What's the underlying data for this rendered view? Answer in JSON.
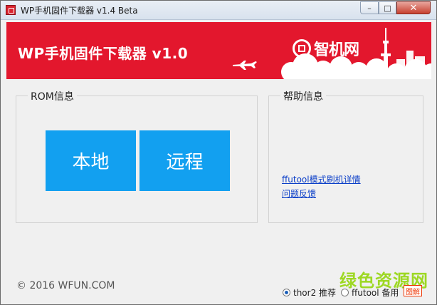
{
  "window": {
    "title": "WP手机固件下载器 v1.4 Beta",
    "controls": {
      "minimize": "–",
      "maximize": "□",
      "close": "✕"
    }
  },
  "banner": {
    "title": "WP手机固件下载器 v1.0",
    "brand": "智机网",
    "bg_color": "#e3172d"
  },
  "rom_group": {
    "legend": "ROM信息",
    "buttons": {
      "local": "本地",
      "remote": "远程"
    },
    "button_color": "#12a0f0"
  },
  "help_group": {
    "legend": "帮助信息",
    "links": [
      "ffutool模式刷机详情",
      "问题反馈"
    ]
  },
  "footer": {
    "copyright": "© 2016 WFUN.COM",
    "radio_options": [
      {
        "label": "thor2 推荐",
        "checked": true
      },
      {
        "label": "ffutool 备用",
        "checked": false
      }
    ],
    "badge": "图解"
  },
  "watermark": "绿色资源网",
  "icons": [
    "app-icon",
    "brand-logo-icon",
    "airplane-icon",
    "tower-icon"
  ]
}
